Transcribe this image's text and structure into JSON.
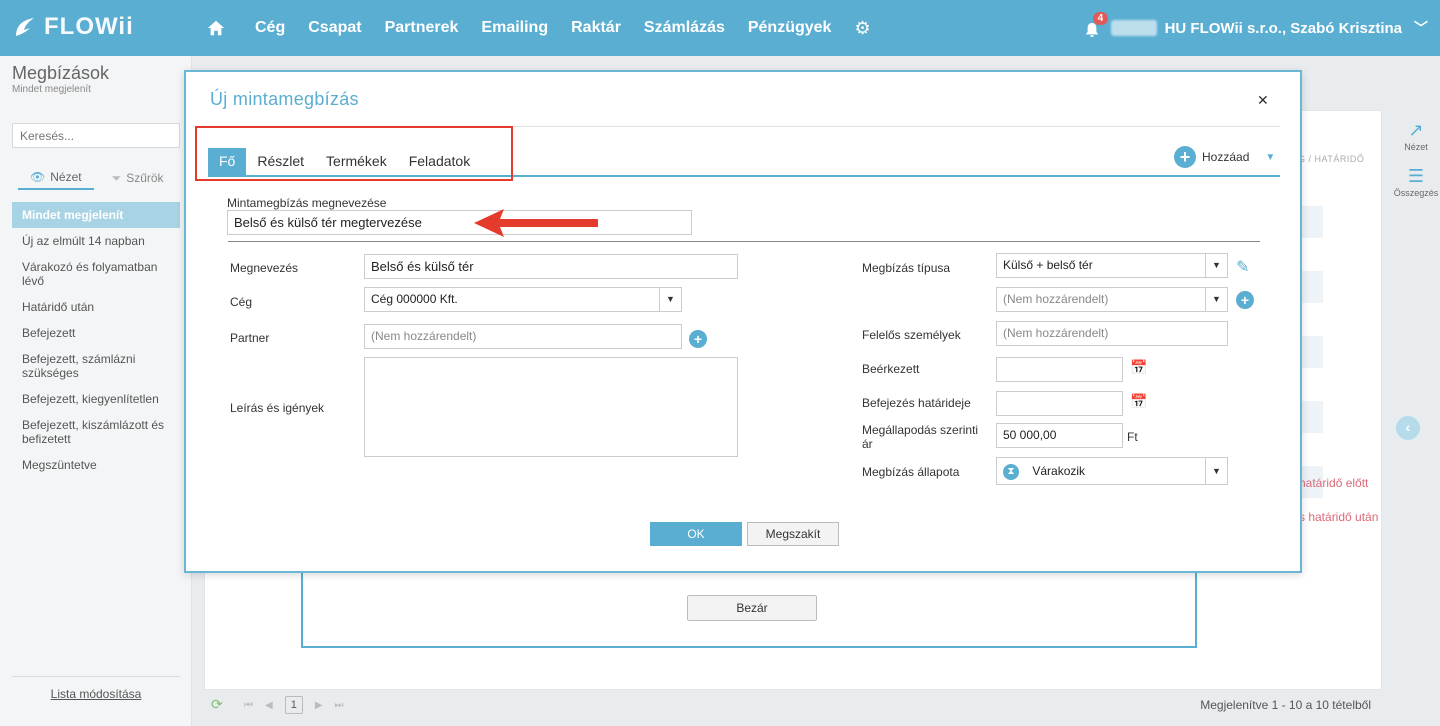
{
  "topbar": {
    "logo_text": "FLOWii",
    "nav": [
      "Cég",
      "Csapat",
      "Partnerek",
      "Emailing",
      "Raktár",
      "Számlázás",
      "Pénzügyek"
    ],
    "notification_count": "4",
    "user": "HU FLOWii s.r.o., Szabó Krisztina"
  },
  "sidebar": {
    "title": "Megbízások",
    "subtitle": "Mindet megjelenít",
    "search_placeholder": "Keresés...",
    "tab_view": "Nézet",
    "tab_filters": "Szűrök",
    "items": [
      "Mindet megjelenít",
      "Új az elmúlt 14 napban",
      "Várakozó és folyamatban lévő",
      "Határidő után",
      "Befejezett",
      "Befejezett, számlázni szükséges",
      "Befejezett, kiegyenlítetlen",
      "Befejezett, kiszámlázott és befizetett",
      "Megszüntetve"
    ],
    "bottom_link": "Lista módosítása"
  },
  "background": {
    "col_header": "G / HATÁRIDŐ",
    "red_text_1": "határidő előtt",
    "red_text_2": "s határidő után",
    "tool_view": "Nézet",
    "tool_summary": "Összegzés",
    "pager_page": "1",
    "pager_info": "Megjelenítve 1 - 10 a 10 tételből",
    "close_button": "Bezár"
  },
  "dialog": {
    "title": "Új mintamegbízás",
    "tabs": [
      "Fő",
      "Részlet",
      "Termékek",
      "Feladatok"
    ],
    "add_label": "Hozzáad",
    "template_name_label": "Mintamegbízás megnevezése",
    "template_name_value": "Belső és külső tér megtervezése",
    "left": {
      "name_label": "Megnevezés",
      "name_value": "Belső és külső tér",
      "company_label": "Cég",
      "company_value": "Cég 000000 Kft.",
      "partner_label": "Partner",
      "partner_placeholder": "(Nem hozzárendelt)",
      "description_label": "Leírás és igények"
    },
    "right": {
      "type_label": "Megbízás típusa",
      "type_value": "Külső + belső tér",
      "type2_placeholder": "(Nem hozzárendelt)",
      "responsible_label": "Felelős személyek",
      "responsible_placeholder": "(Nem hozzárendelt)",
      "arrived_label": "Beérkezett",
      "deadline_label": "Befejezés határideje",
      "price_label": "Megállapodás szerinti ár",
      "price_value": "50 000,00",
      "currency": "Ft",
      "status_label": "Megbízás állapota",
      "status_value": "Várakozik"
    },
    "ok_label": "OK",
    "cancel_label": "Megszakít"
  },
  "colors": {
    "brand": "#5aaed1",
    "highlight": "#e53b2c"
  }
}
